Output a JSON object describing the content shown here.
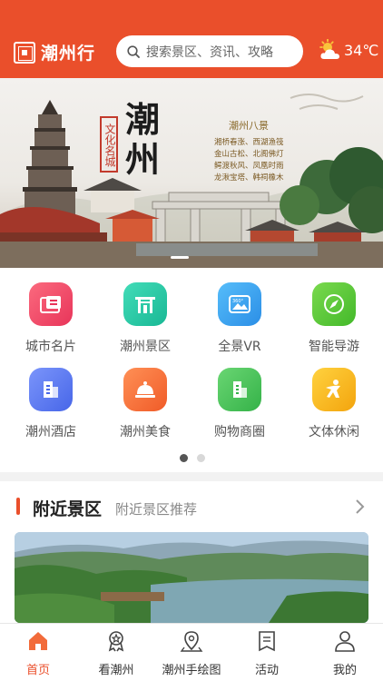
{
  "header": {
    "logo_text": "潮州行",
    "search_placeholder": "搜索景区、资讯、攻略",
    "temperature": "34℃",
    "weather_icon": "partly-cloudy-icon"
  },
  "banner": {
    "title": "潮州",
    "stamp": "文化名城",
    "subtitle": "潮州八景",
    "poem_lines": [
      "湘桥春涨、西湖渔筏",
      "金山古松、北阁佛灯",
      "鳄渡秋风、凤凰时雨",
      "龙湫宝塔、韩祠橡木"
    ]
  },
  "grid": {
    "items": [
      {
        "label": "城市名片",
        "icon": "city-card-icon",
        "color": "#f0476a"
      },
      {
        "label": "潮州景区",
        "icon": "scenic-gate-icon",
        "color": "#2dc8a8"
      },
      {
        "label": "全景VR",
        "icon": "vr-panorama-icon",
        "color": "#3aa6f2"
      },
      {
        "label": "智能导游",
        "icon": "compass-icon",
        "color": "#5cc93a"
      },
      {
        "label": "潮州酒店",
        "icon": "hotel-icon",
        "color": "#5b7cf2"
      },
      {
        "label": "潮州美食",
        "icon": "food-cloche-icon",
        "color": "#f7743d"
      },
      {
        "label": "购物商圈",
        "icon": "shopping-building-icon",
        "color": "#4cc25a"
      },
      {
        "label": "文体休闲",
        "icon": "leisure-figure-icon",
        "color": "#f7b516"
      }
    ]
  },
  "nearby": {
    "title": "附近景区",
    "subtitle": "附近景区推荐"
  },
  "tabbar": {
    "items": [
      {
        "label": "首页",
        "icon": "home-icon",
        "active": true
      },
      {
        "label": "看潮州",
        "icon": "medal-icon",
        "active": false
      },
      {
        "label": "潮州手绘图",
        "icon": "map-pin-icon",
        "active": false
      },
      {
        "label": "活动",
        "icon": "activity-doc-icon",
        "active": false
      },
      {
        "label": "我的",
        "icon": "user-icon",
        "active": false
      }
    ]
  },
  "colors": {
    "brand": "#ea4f2b",
    "header_bg": "#ea4f2b"
  }
}
